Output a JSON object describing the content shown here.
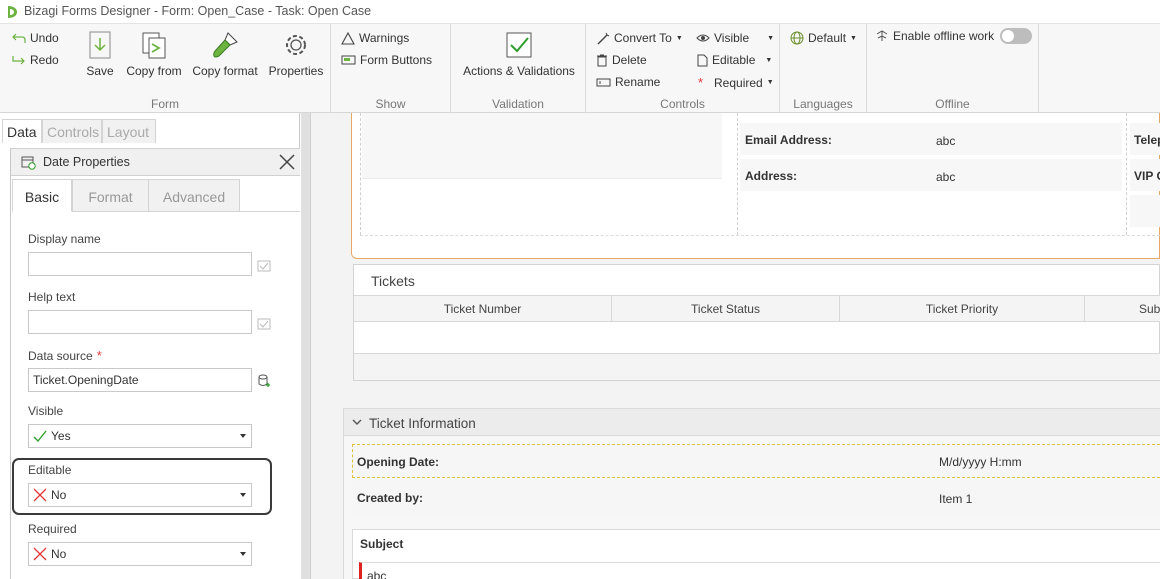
{
  "titlebar": {
    "title": "Bizagi Forms Designer  - Form: Open_Case - Task:  Open Case"
  },
  "ribbon": {
    "undo": "Undo",
    "redo": "Redo",
    "save": "Save",
    "copy_from": "Copy from",
    "copy_format": "Copy format",
    "properties": "Properties",
    "group_form": "Form",
    "warnings": "Warnings",
    "form_buttons": "Form Buttons",
    "group_show": "Show",
    "actions_validations": "Actions & Validations",
    "group_validation": "Validation",
    "convert_to": "Convert To",
    "delete": "Delete",
    "rename": "Rename",
    "visible": "Visible",
    "editable": "Editable",
    "required": "Required",
    "group_controls": "Controls",
    "default_lang": "Default",
    "group_languages": "Languages",
    "enable_offline": "Enable offline work",
    "group_offline": "Offline"
  },
  "panel_tabs": {
    "data": "Data",
    "controls": "Controls",
    "layout": "Layout"
  },
  "dialog": {
    "title": "Date Properties",
    "tabs": {
      "basic": "Basic",
      "format": "Format",
      "advanced": "Advanced"
    },
    "display_name": {
      "label": "Display name",
      "value": ""
    },
    "help_text": {
      "label": "Help text",
      "value": ""
    },
    "data_source": {
      "label": "Data source",
      "required_mark": "*",
      "value": "Ticket.OpeningDate"
    },
    "visible": {
      "label": "Visible",
      "value": "Yes"
    },
    "editable": {
      "label": "Editable",
      "value": "No"
    },
    "required": {
      "label": "Required",
      "value": "No"
    }
  },
  "form": {
    "contact": {
      "email_label": "Email Address:",
      "email_value": "abc",
      "address_label": "Address:",
      "address_value": "abc",
      "right_label_1": "Telep",
      "right_label_2": "VIP C"
    },
    "tickets": {
      "title": "Tickets",
      "columns": [
        "Ticket Number",
        "Ticket Status",
        "Ticket Priority",
        "Sub"
      ]
    },
    "ticket_information": {
      "title": "Ticket Information",
      "opening_date_label": "Opening Date:",
      "opening_date_value": "M/d/yyyy H:mm",
      "created_by_label": "Created by:",
      "created_by_value": "Item 1",
      "subject_label": "Subject",
      "subject_value": "abc"
    }
  },
  "colors": {
    "accent_orange": "#e8a866",
    "highlight_border": "#3a3a3a",
    "required_red": "#e23a3a",
    "check_green": "#2e9e2e"
  }
}
